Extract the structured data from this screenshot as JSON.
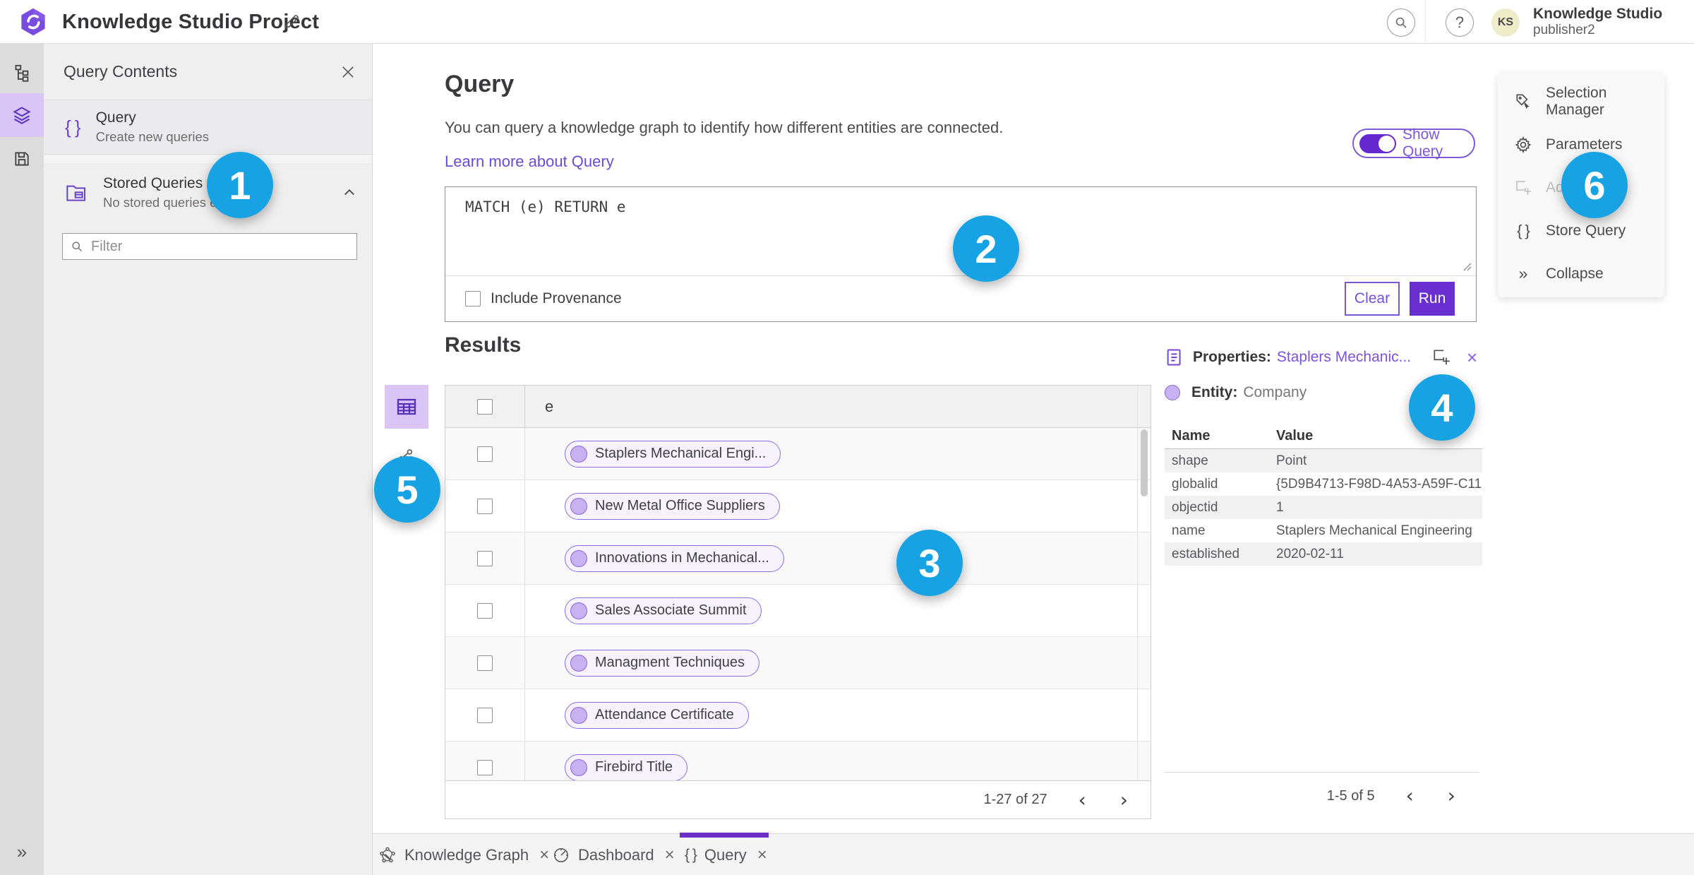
{
  "app": {
    "title": "Knowledge Studio Project",
    "user_name": "Knowledge Studio",
    "user_role": "publisher2",
    "avatar_initials": "KS"
  },
  "icons": {
    "braces": "{ }",
    "close": "×",
    "question": "?",
    "chev_left": "‹",
    "chev_right": "›",
    "collapse": "»"
  },
  "sidebar": {
    "panel_title": "Query Contents",
    "items": [
      {
        "title": "Query",
        "subtitle": "Create new queries"
      },
      {
        "title": "Stored Queries",
        "subtitle": "No stored queries exist"
      }
    ],
    "filter_placeholder": "Filter"
  },
  "query": {
    "heading": "Query",
    "description": "You can query a knowledge graph to identify how different entities are connected.",
    "learn_more": "Learn more about Query",
    "show_query_label": "Show Query",
    "query_text": "MATCH (e) RETURN e",
    "include_provenance_label": "Include Provenance",
    "clear_label": "Clear",
    "run_label": "Run"
  },
  "results": {
    "heading": "Results",
    "column": "e",
    "rows": [
      "Staplers Mechanical Engi...",
      "New Metal Office Suppliers",
      "Innovations in Mechanical...",
      "Sales Associate Summit",
      "Managment Techniques",
      "Attendance Certificate",
      "Firebird Title"
    ],
    "pagination": "1-27 of 27"
  },
  "properties": {
    "title": "Properties:",
    "entity_link": "Staplers Mechanic...",
    "entity_label": "Entity:",
    "entity_type": "Company",
    "columns": {
      "name": "Name",
      "value": "Value"
    },
    "rows": [
      [
        "shape",
        "Point"
      ],
      [
        "globalid",
        "{5D9B4713-F98D-4A53-A59F-C11..."
      ],
      [
        "objectid",
        "1"
      ],
      [
        "name",
        "Staplers Mechanical Engineering"
      ],
      [
        "established",
        "2020-02-11"
      ]
    ],
    "pagination": "1-5 of 5"
  },
  "side_menu": {
    "items": [
      "Selection Manager",
      "Parameters",
      "Add",
      "Store Query",
      "Collapse"
    ]
  },
  "tabs": [
    {
      "label": "Knowledge Graph"
    },
    {
      "label": "Dashboard"
    },
    {
      "label": "Query"
    }
  ],
  "badges": [
    "1",
    "2",
    "3",
    "4",
    "5",
    "6"
  ],
  "colors": {
    "accent_purple": "#6a30c9",
    "link_purple": "#6a4cd4",
    "badge_blue": "#17a3e3",
    "pill_fill": "#c9b2f2",
    "pill_border": "#8b63dd"
  }
}
